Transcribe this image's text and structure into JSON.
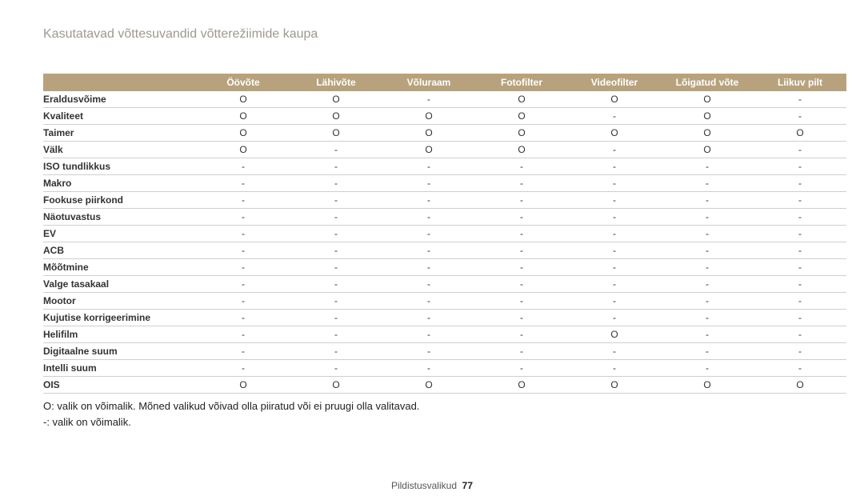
{
  "chart_data": {
    "type": "table",
    "title": "Kasutatavad võttesuvandid võtterežiimide kaupa",
    "columns": [
      "Öövõte",
      "Lähivõte",
      "Võluraam",
      "Fotofilter",
      "Videofilter",
      "Lõigatud võte",
      "Liikuv pilt"
    ],
    "rows": [
      {
        "label": "Eraldusvõime",
        "values": [
          "O",
          "O",
          "-",
          "O",
          "O",
          "O",
          "-"
        ]
      },
      {
        "label": "Kvaliteet",
        "values": [
          "O",
          "O",
          "O",
          "O",
          "-",
          "O",
          "-"
        ]
      },
      {
        "label": "Taimer",
        "values": [
          "O",
          "O",
          "O",
          "O",
          "O",
          "O",
          "O"
        ]
      },
      {
        "label": "Välk",
        "values": [
          "O",
          "-",
          "O",
          "O",
          "-",
          "O",
          "-"
        ]
      },
      {
        "label": "ISO tundlikkus",
        "values": [
          "-",
          "-",
          "-",
          "-",
          "-",
          "-",
          "-"
        ]
      },
      {
        "label": "Makro",
        "values": [
          "-",
          "-",
          "-",
          "-",
          "-",
          "-",
          "-"
        ]
      },
      {
        "label": "Fookuse piirkond",
        "values": [
          "-",
          "-",
          "-",
          "-",
          "-",
          "-",
          "-"
        ]
      },
      {
        "label": "Näotuvastus",
        "values": [
          "-",
          "-",
          "-",
          "-",
          "-",
          "-",
          "-"
        ]
      },
      {
        "label": "EV",
        "values": [
          "-",
          "-",
          "-",
          "-",
          "-",
          "-",
          "-"
        ]
      },
      {
        "label": "ACB",
        "values": [
          "-",
          "-",
          "-",
          "-",
          "-",
          "-",
          "-"
        ]
      },
      {
        "label": "Mõõtmine",
        "values": [
          "-",
          "-",
          "-",
          "-",
          "-",
          "-",
          "-"
        ]
      },
      {
        "label": "Valge tasakaal",
        "values": [
          "-",
          "-",
          "-",
          "-",
          "-",
          "-",
          "-"
        ]
      },
      {
        "label": "Mootor",
        "values": [
          "-",
          "-",
          "-",
          "-",
          "-",
          "-",
          "-"
        ]
      },
      {
        "label": "Kujutise korrigeerimine",
        "values": [
          "-",
          "-",
          "-",
          "-",
          "-",
          "-",
          "-"
        ]
      },
      {
        "label": "Helifilm",
        "values": [
          "-",
          "-",
          "-",
          "-",
          "O",
          "-",
          "-"
        ]
      },
      {
        "label": "Digitaalne suum",
        "values": [
          "-",
          "-",
          "-",
          "-",
          "-",
          "-",
          "-"
        ]
      },
      {
        "label": "Intelli suum",
        "values": [
          "-",
          "-",
          "-",
          "-",
          "-",
          "-",
          "-"
        ]
      },
      {
        "label": "OIS",
        "values": [
          "O",
          "O",
          "O",
          "O",
          "O",
          "O",
          "O"
        ]
      }
    ],
    "notes": [
      "O: valik on võimalik. Mõned valikud võivad olla piiratud või ei pruugi olla valitavad.",
      "-: valik on võimalik."
    ]
  },
  "footer": {
    "section": "Pildistusvalikud",
    "page": "77"
  }
}
